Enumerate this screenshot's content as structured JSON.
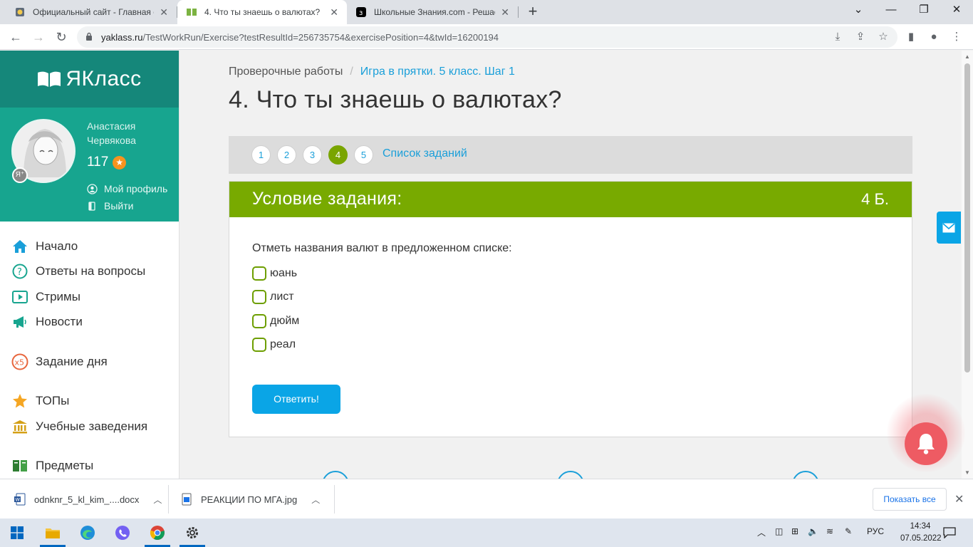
{
  "browser": {
    "tabs": [
      {
        "title": "Официальный сайт - Главная ст",
        "active": false
      },
      {
        "title": "4. Что ты знаешь о валютах?",
        "active": true
      },
      {
        "title": "Школьные Знания.com - Решае",
        "active": false
      }
    ],
    "new_tab_glyph": "+",
    "url_host": "yaklass.ru",
    "url_path": "/TestWorkRun/Exercise?testResultId=256735754&exercisePosition=4&twId=16200194"
  },
  "sidebar": {
    "logo_text": "ЯКласс",
    "user_name": "Анастасия Червякова",
    "points": "117",
    "profile_link": "Мой профиль",
    "logout_link": "Выйти",
    "menu": [
      {
        "label": "Начало",
        "icon": "home-icon"
      },
      {
        "label": "Ответы на вопросы",
        "icon": "question-icon"
      },
      {
        "label": "Стримы",
        "icon": "play-icon"
      },
      {
        "label": "Новости",
        "icon": "megaphone-icon"
      },
      {
        "label": "Задание дня",
        "icon": "x5-icon"
      },
      {
        "label": "ТОПы",
        "icon": "star-icon"
      },
      {
        "label": "Учебные заведения",
        "icon": "institution-icon"
      },
      {
        "label": "Предметы",
        "icon": "books-icon"
      }
    ]
  },
  "main": {
    "breadcrumb": {
      "root": "Проверочные работы",
      "separator": "/",
      "current": "Игра в прятки. 5 класс. Шаг 1"
    },
    "title": "4. Что ты знаешь о валютах?",
    "steps": [
      "1",
      "2",
      "3",
      "4",
      "5"
    ],
    "current_step": "4",
    "task_list_link": "Список заданий",
    "card": {
      "header": "Условие задания:",
      "points": "4 Б.",
      "question": "Отметь названия валют в предложенном списке:",
      "options": [
        "юань",
        "лист",
        "дюйм",
        "реал"
      ],
      "answer_button": "Ответить!"
    }
  },
  "downloads": {
    "items": [
      {
        "name": "odnknr_5_kl_kim_....docx",
        "icon": "word-doc-icon"
      },
      {
        "name": "РЕАКЦИИ ПО МГА.jpg",
        "icon": "image-file-icon"
      }
    ],
    "show_all": "Показать все"
  },
  "taskbar": {
    "language": "РУС",
    "time": "14:34",
    "date": "07.05.2022"
  },
  "colors": {
    "brand_dark": "#15877a",
    "brand": "#17a58f",
    "green_header": "#78aa00",
    "link_blue": "#1a9fd9",
    "button_blue": "#0aa5e6",
    "bell_red": "#ee5b63"
  }
}
